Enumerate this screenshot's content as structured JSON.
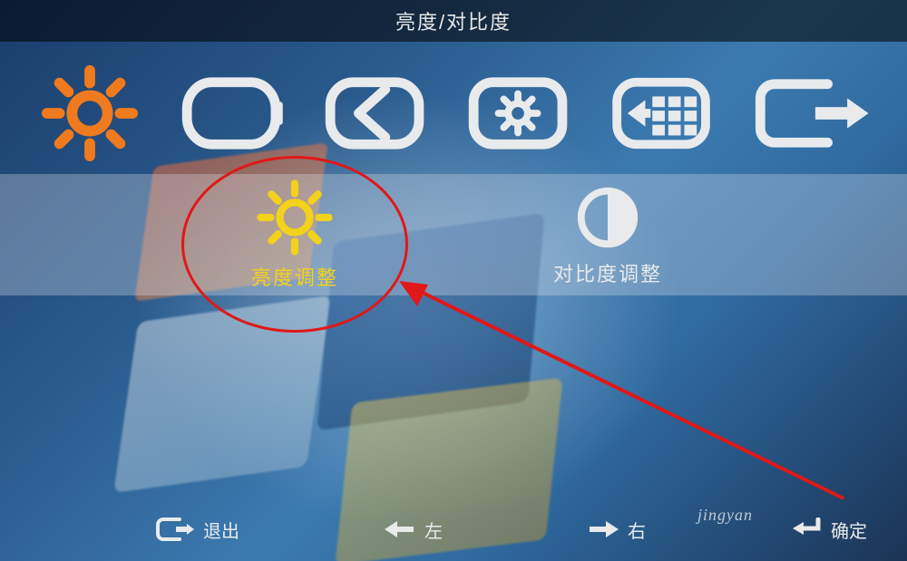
{
  "colors": {
    "accent_selected": "#f2d21a",
    "icon_default": "#e8eaec",
    "annotation": "#e01818"
  },
  "title": "亮度/对比度",
  "tabs": [
    {
      "id": "brightness-contrast",
      "icon": "sun-icon",
      "selected": true
    },
    {
      "id": "picture",
      "icon": "screen-icon",
      "selected": false
    },
    {
      "id": "geometry",
      "icon": "geometry-icon",
      "selected": false
    },
    {
      "id": "color-settings",
      "icon": "gear-box-icon",
      "selected": false
    },
    {
      "id": "osd-settings",
      "icon": "grid-box-icon",
      "selected": false
    },
    {
      "id": "exit-tab",
      "icon": "exit-icon",
      "selected": false
    }
  ],
  "submenu": {
    "brightness": {
      "label": "亮度调整",
      "icon": "sun-icon",
      "selected": true
    },
    "contrast": {
      "label": "对比度调整",
      "icon": "contrast-icon",
      "selected": false
    }
  },
  "hints": {
    "exit": {
      "label": "退出",
      "icon": "exit-icon"
    },
    "left": {
      "label": "左",
      "icon": "arrow-left-icon"
    },
    "right": {
      "label": "右",
      "icon": "arrow-right-icon"
    },
    "ok": {
      "label": "确定",
      "icon": "enter-icon"
    }
  },
  "watermark": "jingyan"
}
